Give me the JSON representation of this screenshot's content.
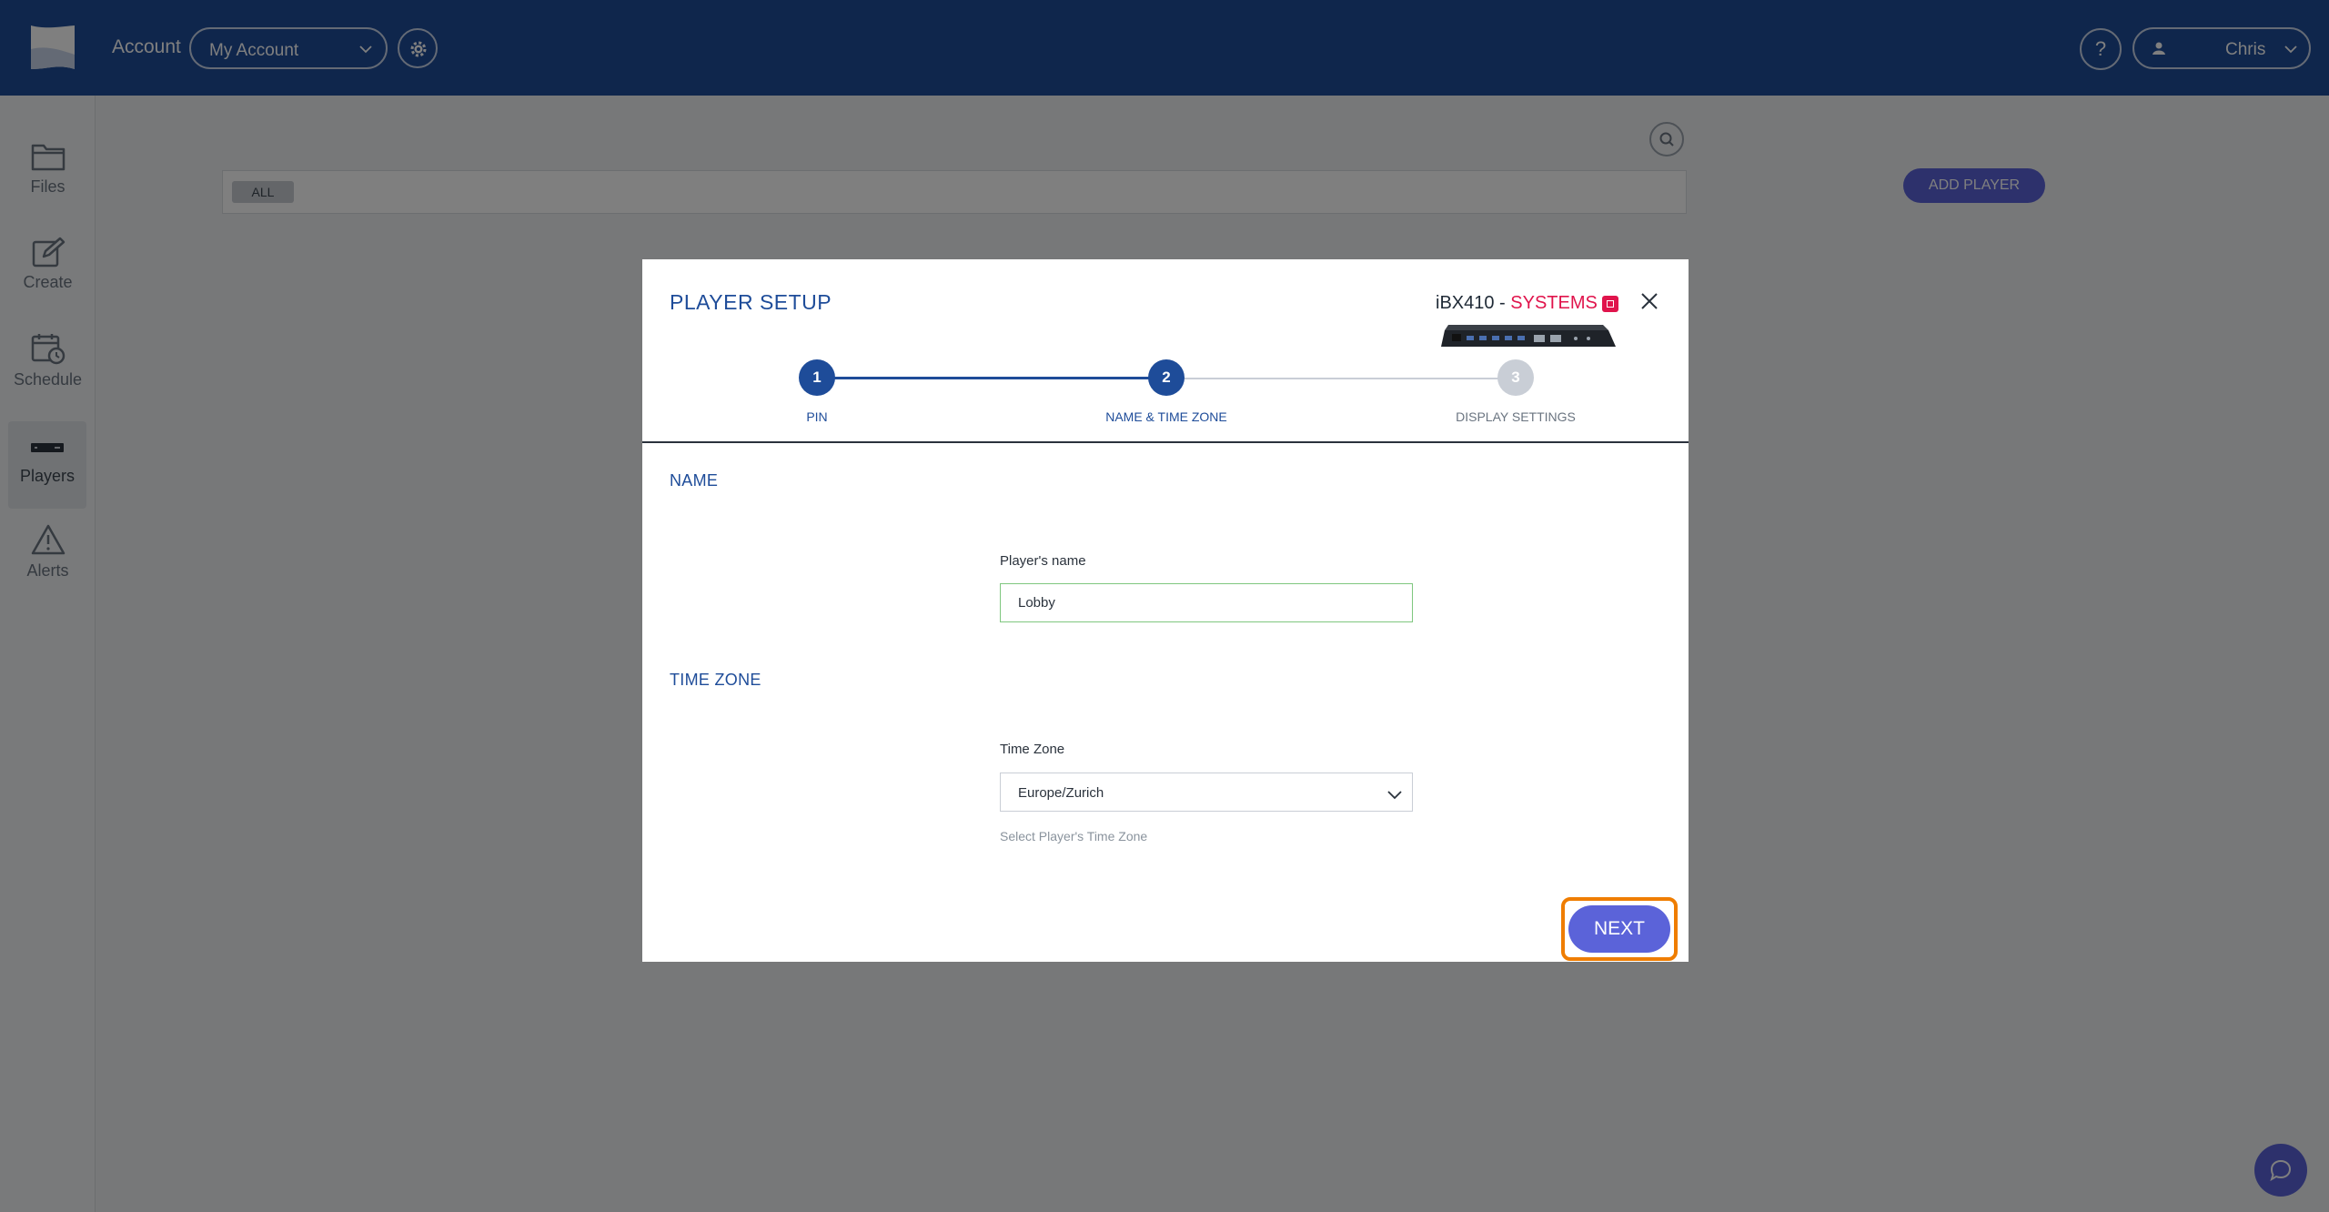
{
  "header": {
    "account_label": "Account",
    "account_value": "My Account",
    "help_label": "?",
    "user_name": "Chris"
  },
  "sidebar": {
    "items": [
      {
        "label": "Files"
      },
      {
        "label": "Create"
      },
      {
        "label": "Schedule"
      },
      {
        "label": "Players"
      },
      {
        "label": "Alerts"
      }
    ]
  },
  "page": {
    "filter_chip": "ALL",
    "add_player_label": "ADD PLAYER"
  },
  "modal": {
    "title": "PLAYER SETUP",
    "device_model": "iBX410 - ",
    "device_brand": "SYSTEMS",
    "steps": [
      {
        "number": "1",
        "label": "PIN",
        "state": "done"
      },
      {
        "number": "2",
        "label": "NAME & TIME ZONE",
        "state": "current"
      },
      {
        "number": "3",
        "label": "DISPLAY SETTINGS",
        "state": "todo"
      }
    ],
    "name_section": "NAME",
    "name_field_label": "Player's name",
    "name_field_value": "Lobby",
    "timezone_section": "TIME ZONE",
    "timezone_field_label": "Time Zone",
    "timezone_value": "Europe/Zurich",
    "timezone_helper": "Select Player's Time Zone",
    "next_label": "NEXT"
  },
  "colors": {
    "header_blue": "#1e4c99",
    "accent_purple": "#5b63d9",
    "brand_red": "#e0144c",
    "highlight_orange": "#ef7d00",
    "input_valid_green": "#7fc77f"
  },
  "icons": [
    "logo-icon",
    "chevron-down-icon",
    "gear-icon",
    "user-icon",
    "folder-icon",
    "edit-icon",
    "calendar-clock-icon",
    "player-device-icon",
    "alert-triangle-icon",
    "search-icon",
    "chat-icon",
    "close-icon"
  ]
}
